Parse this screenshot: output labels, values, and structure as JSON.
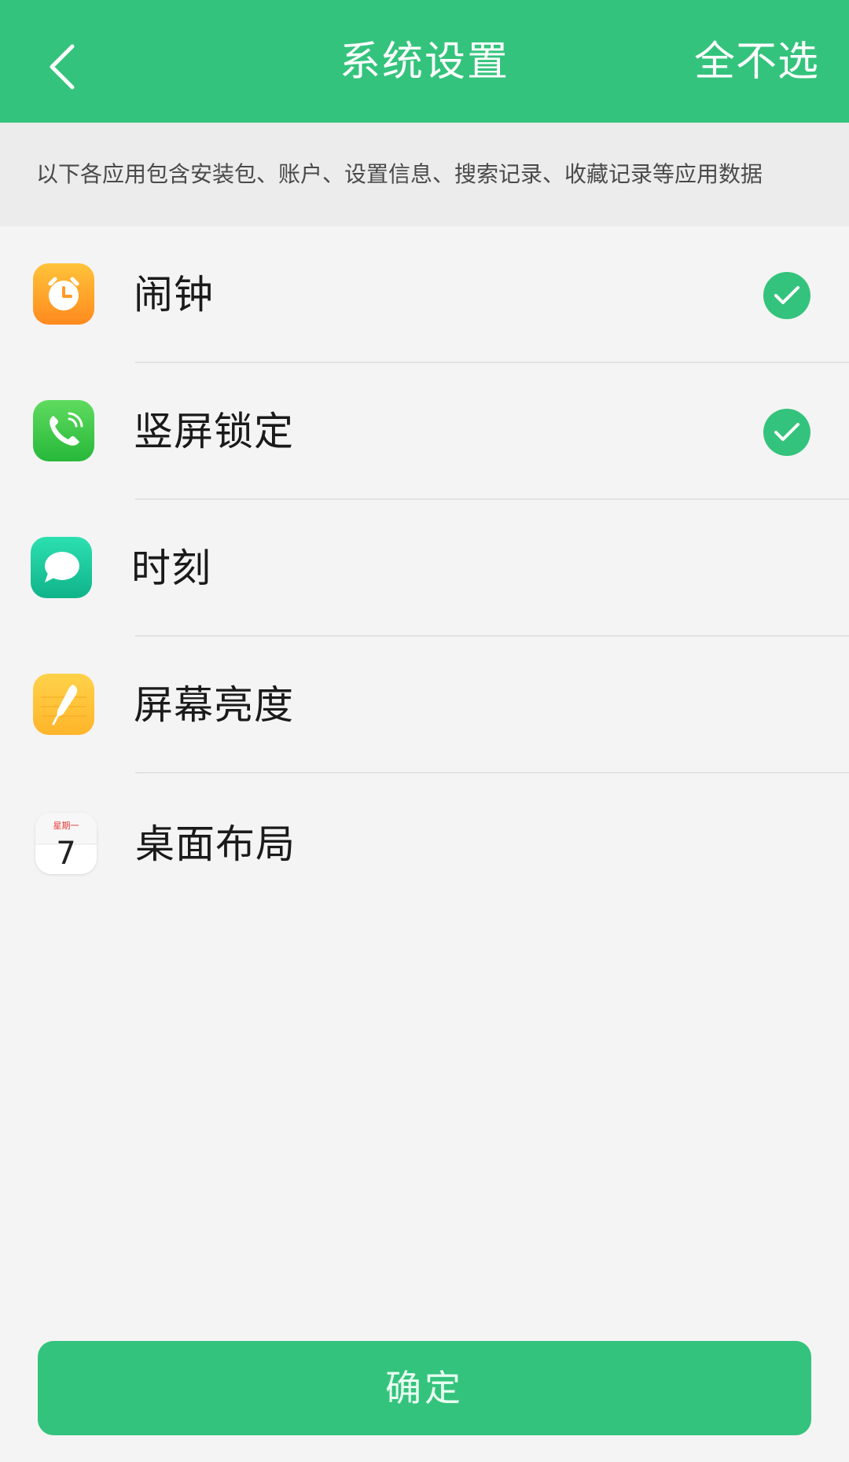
{
  "header": {
    "title": "系统设置",
    "deselect_all": "全不选",
    "accent_color": "#34c37c"
  },
  "info": {
    "text": "以下各应用包含安装包、账户、设置信息、搜索记录、收藏记录等应用数据"
  },
  "apps": [
    {
      "label": "闹钟",
      "icon": "alarm-clock-icon",
      "checked": true
    },
    {
      "label": "竖屏锁定",
      "icon": "phone-icon",
      "checked": true
    },
    {
      "label": "时刻",
      "icon": "message-bubble-icon",
      "checked": false
    },
    {
      "label": "屏幕亮度",
      "icon": "notes-pencil-icon",
      "checked": false
    },
    {
      "label": "桌面布局",
      "icon": "calendar-icon",
      "checked": false,
      "calendar_weekday": "星期一",
      "calendar_day": "7"
    }
  ],
  "confirm_label": "确定"
}
